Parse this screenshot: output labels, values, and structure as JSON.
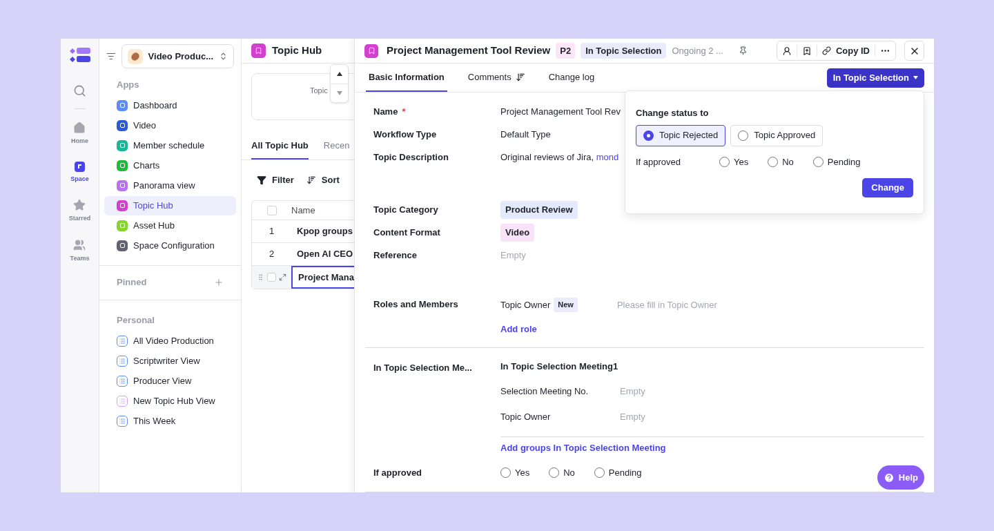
{
  "rail": {
    "items": [
      {
        "kind": "home",
        "label": "Home",
        "selected": false
      },
      {
        "kind": "space",
        "label": "Space",
        "selected": true
      },
      {
        "kind": "star",
        "label": "Starred",
        "selected": false
      },
      {
        "kind": "teams",
        "label": "Teams",
        "selected": false
      }
    ]
  },
  "sidebar": {
    "workspace": "Video Produc...",
    "apps_title": "Apps",
    "apps": [
      {
        "label": "Dashboard",
        "color": "#5b8cf7",
        "selected": false
      },
      {
        "label": "Video",
        "color": "#2a5bd7",
        "selected": false
      },
      {
        "label": "Member schedule",
        "color": "#17b897",
        "selected": false
      },
      {
        "label": "Charts",
        "color": "#1fba3a",
        "selected": false
      },
      {
        "label": "Panorama view",
        "color": "#b772f0",
        "selected": false
      },
      {
        "label": "Topic Hub",
        "color": "#d33fcf",
        "selected": true
      },
      {
        "label": "Asset Hub",
        "color": "#84d62a",
        "selected": false
      },
      {
        "label": "Space Configuration",
        "color": "#5f6470",
        "selected": false
      }
    ],
    "pinned_title": "Pinned",
    "personal_title": "Personal",
    "personal": [
      {
        "label": "All Video Production",
        "color": "#5b8cf7"
      },
      {
        "label": "Scriptwriter View",
        "color": "#5b8cf7"
      },
      {
        "label": "Producer View",
        "color": "#5b8cf7"
      },
      {
        "label": "New Topic Hub View",
        "color": "#d99cf5"
      },
      {
        "label": "This Week",
        "color": "#5b8cf7"
      }
    ]
  },
  "hub": {
    "title": "Topic Hub",
    "stat_label": "Topic",
    "tabs": [
      {
        "label": "All Topic Hub",
        "selected": true
      },
      {
        "label": "Recen",
        "selected": false
      }
    ],
    "filter": "Filter",
    "sort": "Sort",
    "name_column": "Name",
    "all_checked": false,
    "rows": [
      {
        "number": "1",
        "name": "Kpop groups",
        "selected": false
      },
      {
        "number": "2",
        "name": "Open AI CEO",
        "selected": false
      },
      {
        "name": "Project Mana",
        "selected": true,
        "checked": false
      }
    ]
  },
  "detail": {
    "title": "Project Management Tool Review",
    "priority": "P2",
    "status": "In Topic Selection",
    "progress": "Ongoing 2 ...",
    "copy_id": "Copy ID",
    "tabs": [
      {
        "label": "Basic Information",
        "selected": true
      },
      {
        "label": "Comments",
        "selected": false
      },
      {
        "label": "Change log",
        "selected": false
      }
    ],
    "status_button": "In Topic Selection",
    "fields": [
      {
        "kind": "text",
        "label": "Name",
        "required_mark": "*",
        "value": "Project Management Tool Rev"
      },
      {
        "kind": "text",
        "label": "Workflow Type",
        "value": "Default Type"
      },
      {
        "kind": "description",
        "label": "Topic Description",
        "value": "Original reviews of Jira,",
        "link": "mond"
      },
      {
        "kind": "tag",
        "label": "Topic Category",
        "value": "Product Review",
        "color": "#e3eafd"
      },
      {
        "kind": "tag",
        "label": "Content Format",
        "value": "Video",
        "color": "#fae3f8"
      },
      {
        "kind": "empty",
        "label": "Reference",
        "placeholder": "Empty"
      }
    ],
    "roles": {
      "label": "Roles and Members",
      "role": "Topic Owner",
      "badge": "New",
      "placeholder": "Please fill in Topic Owner",
      "add": "Add role"
    },
    "meeting": {
      "label": "In Topic Selection Me...",
      "group": "In Topic Selection Meeting1",
      "fields": [
        {
          "label": "Selection Meeting No.",
          "placeholder": "Empty"
        },
        {
          "label": "Topic Owner",
          "placeholder": "Empty"
        }
      ],
      "add": "Add groups In Topic Selection Meeting"
    },
    "approved": {
      "label": "If approved",
      "options": [
        {
          "label": "Yes",
          "selected": false
        },
        {
          "label": "No",
          "selected": false
        },
        {
          "label": "Pending",
          "selected": false
        }
      ]
    }
  },
  "popover": {
    "title": "Change status to",
    "statuses": [
      {
        "label": "Topic Rejected",
        "selected": true
      },
      {
        "label": "Topic Approved",
        "selected": false
      }
    ],
    "approved_label": "If approved",
    "approved": [
      {
        "label": "Yes",
        "selected": false
      },
      {
        "label": "No",
        "selected": false
      },
      {
        "label": "Pending",
        "selected": false
      }
    ],
    "button": "Change"
  },
  "help": "Help"
}
